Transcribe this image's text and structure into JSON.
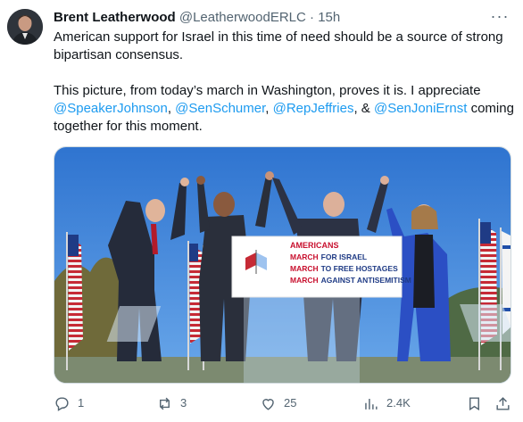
{
  "tweet": {
    "author": {
      "name": "Brent Leatherwood",
      "handle": "@LeatherwoodERLC",
      "separator": "·",
      "time": "15h"
    },
    "more_label": "···",
    "text": {
      "line1": "American support for Israel in this time of need should be a source of strong bipartisan consensus.",
      "part1": "This picture, from today’s march in Washington, proves it is. I appreciate ",
      "mention1": "@SpeakerJohnson",
      "sep1": ", ",
      "mention2": "@SenSchumer",
      "sep2": ", ",
      "mention3": "@RepJeffries",
      "sep3": ", & ",
      "mention4": "@SenJoniErnst",
      "part2": " coming together for this moment."
    },
    "media": {
      "podium_sign": {
        "line1_a": "AMERICANS",
        "line2_a": "MARCH",
        "line2_b": "FOR ISRAEL",
        "line3_a": "MARCH",
        "line3_b": "TO FREE HOSTAGES",
        "line4_a": "MARCH",
        "line4_b": "AGAINST ANTISEMITISM"
      }
    },
    "actions": {
      "replies": "1",
      "reposts": "3",
      "likes": "25",
      "views": "2.4K"
    },
    "colors": {
      "accent": "#1d9bf0",
      "muted": "#536471",
      "sky": "#3d7fd6",
      "sign_red": "#c8102e"
    }
  }
}
